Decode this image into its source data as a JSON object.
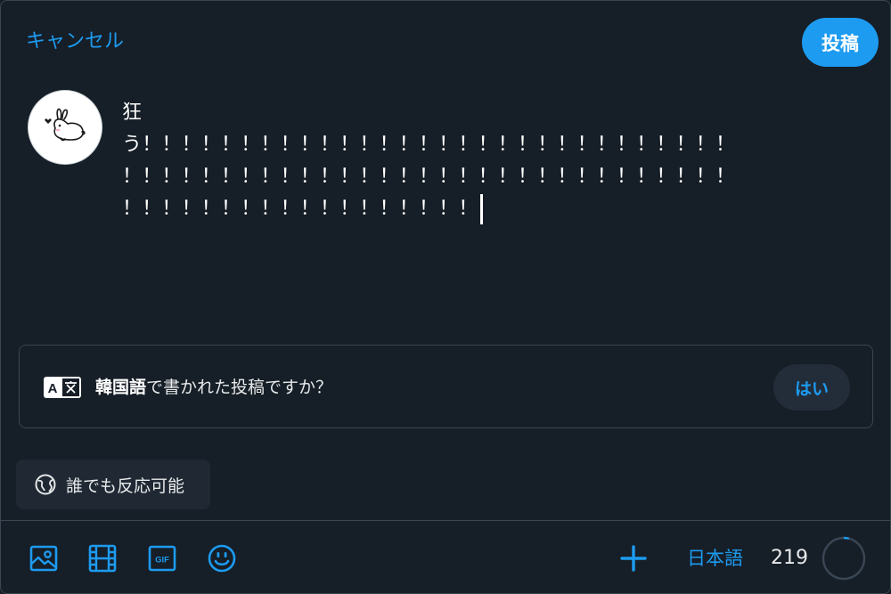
{
  "header": {
    "cancel_label": "キャンセル",
    "post_label": "投稿"
  },
  "compose": {
    "lines": [
      "狂",
      "う！！！！！！！！！！！！！！！！！！！！！！！！！！！！！！",
      "！！！！！！！！！！！！！！！！！！！！！！！！！！！！！！！",
      "！！！！！！！！！！！！！！！！！！"
    ]
  },
  "translate_prompt": {
    "icon": "translate-icon",
    "language": "韓国語",
    "question": "で書かれた投稿ですか？",
    "yes_label": "はい"
  },
  "reply_setting": {
    "icon": "globe-icon",
    "label": "誰でも反応可能"
  },
  "toolbar": {
    "tools": [
      "image-icon",
      "video-icon",
      "gif-icon",
      "emoji-icon"
    ],
    "add_icon": "plus-icon",
    "language_label": "日本語",
    "remaining_count": "219",
    "used_fraction": 0.04
  },
  "colors": {
    "accent": "#1d9bf0",
    "background": "#161e27",
    "border": "#3a4654"
  }
}
